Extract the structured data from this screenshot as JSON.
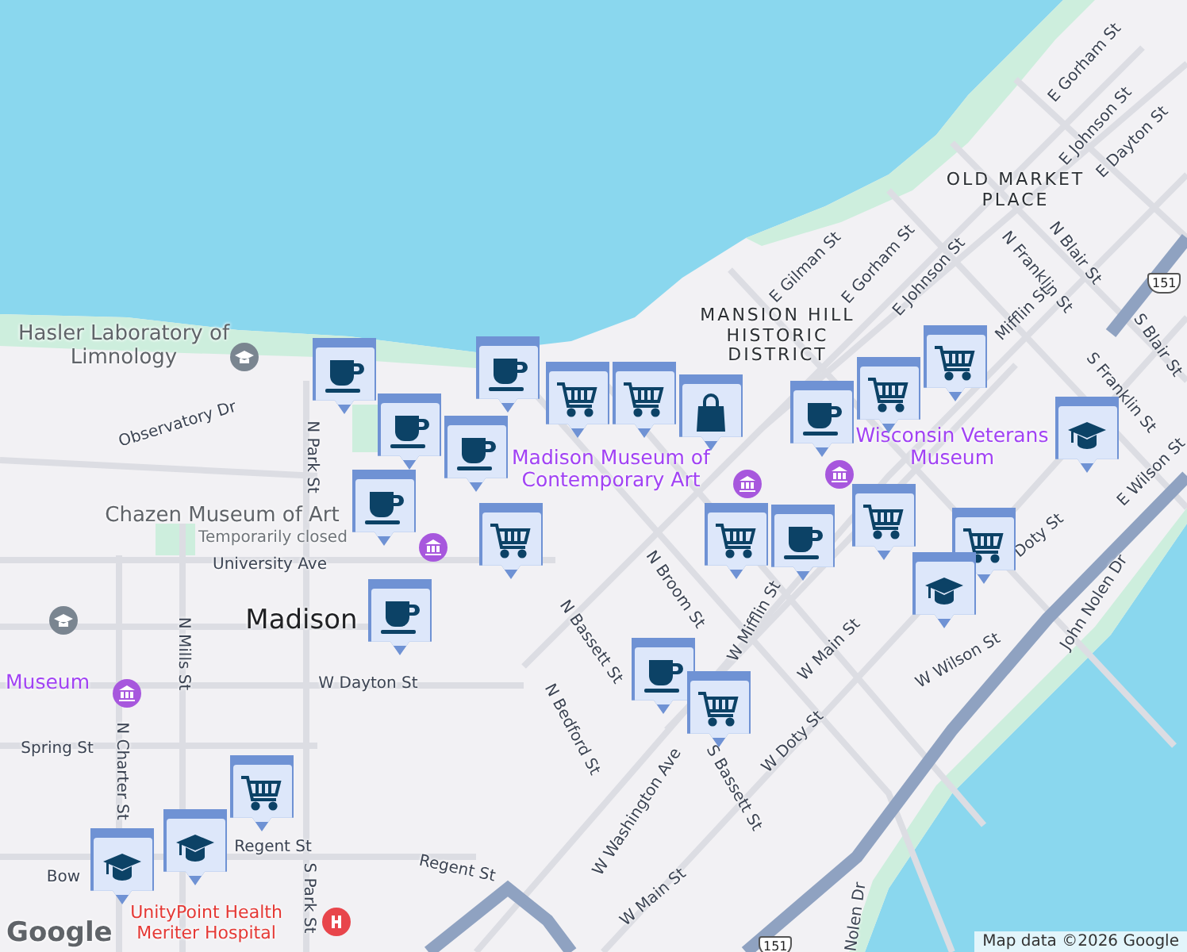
{
  "map": {
    "labels": [
      {
        "text": "Hasler Laboratory of Limnology",
        "kind": "poi"
      },
      {
        "text": "Observatory Dr",
        "kind": "street"
      },
      {
        "text": "N Park St",
        "kind": "street"
      },
      {
        "text": "Chazen Museum of Art",
        "kind": "poi"
      },
      {
        "text": "Temporarily closed",
        "kind": "note"
      },
      {
        "text": "University Ave",
        "kind": "street"
      },
      {
        "text": "Madison",
        "kind": "city"
      },
      {
        "text": "N Mills St",
        "kind": "street"
      },
      {
        "text": "Museum",
        "kind": "museum"
      },
      {
        "text": "W Dayton St",
        "kind": "street"
      },
      {
        "text": "Spring St",
        "kind": "street"
      },
      {
        "text": "N Charter St",
        "kind": "street"
      },
      {
        "text": "Regent St",
        "kind": "street"
      },
      {
        "text": "Bow",
        "kind": "street"
      },
      {
        "text": "S Park St",
        "kind": "street"
      },
      {
        "text": "Regent St",
        "kind": "street"
      },
      {
        "text": "UnityPoint Health Meriter Hospital",
        "kind": "hospital"
      },
      {
        "text": "N Bassett St",
        "kind": "street"
      },
      {
        "text": "N Broom St",
        "kind": "street"
      },
      {
        "text": "W Mifflin St",
        "kind": "street"
      },
      {
        "text": "N Bedford St",
        "kind": "street"
      },
      {
        "text": "W Washington Ave",
        "kind": "street"
      },
      {
        "text": "S Bassett St",
        "kind": "street"
      },
      {
        "text": "W Main St",
        "kind": "street"
      },
      {
        "text": "W Wilson St",
        "kind": "street"
      },
      {
        "text": "W Doty St",
        "kind": "street"
      },
      {
        "text": "W Main St",
        "kind": "street"
      },
      {
        "text": "John Nolen Dr",
        "kind": "street"
      },
      {
        "text": "Nolen Dr",
        "kind": "street"
      },
      {
        "text": "OLD MARKET PLACE",
        "kind": "district"
      },
      {
        "text": "MANSION HILL HISTORIC DISTRICT",
        "kind": "district"
      },
      {
        "text": "Madison Museum of Contemporary Art",
        "kind": "museum"
      },
      {
        "text": "Wisconsin Veterans Museum",
        "kind": "museum"
      },
      {
        "text": "E Gilman St",
        "kind": "street"
      },
      {
        "text": "E Gorham St",
        "kind": "street"
      },
      {
        "text": "E Johnson St",
        "kind": "street"
      },
      {
        "text": "N Franklin St",
        "kind": "street"
      },
      {
        "text": "N Blair St",
        "kind": "street"
      },
      {
        "text": "E Gorham St",
        "kind": "street"
      },
      {
        "text": "E Johnson St",
        "kind": "street"
      },
      {
        "text": "E Dayton St",
        "kind": "street"
      },
      {
        "text": "Mifflin St",
        "kind": "street"
      },
      {
        "text": "S Blair St",
        "kind": "street"
      },
      {
        "text": "S Franklin St",
        "kind": "street"
      },
      {
        "text": "Doty St",
        "kind": "street"
      },
      {
        "text": "E Wilson St",
        "kind": "street"
      }
    ],
    "poi_icons": [
      {
        "kind": "school"
      },
      {
        "kind": "museum"
      },
      {
        "kind": "school"
      },
      {
        "kind": "museum"
      },
      {
        "kind": "hospital"
      },
      {
        "kind": "museum"
      },
      {
        "kind": "museum"
      }
    ],
    "shields": [
      {
        "text": "151"
      },
      {
        "text": "151"
      }
    ],
    "markers": [
      {
        "kind": "coffee"
      },
      {
        "kind": "coffee"
      },
      {
        "kind": "coffee"
      },
      {
        "kind": "coffee"
      },
      {
        "kind": "coffee"
      },
      {
        "kind": "coffee"
      },
      {
        "kind": "coffee"
      },
      {
        "kind": "coffee"
      },
      {
        "kind": "coffee"
      },
      {
        "kind": "cart"
      },
      {
        "kind": "cart"
      },
      {
        "kind": "cart"
      },
      {
        "kind": "cart"
      },
      {
        "kind": "cart"
      },
      {
        "kind": "cart"
      },
      {
        "kind": "cart"
      },
      {
        "kind": "cart"
      },
      {
        "kind": "cart"
      },
      {
        "kind": "cart"
      },
      {
        "kind": "bag"
      },
      {
        "kind": "school"
      },
      {
        "kind": "school"
      },
      {
        "kind": "school"
      },
      {
        "kind": "school"
      }
    ]
  },
  "footer": {
    "logo": "Google",
    "attribution": "Map data ©2026 Google"
  }
}
